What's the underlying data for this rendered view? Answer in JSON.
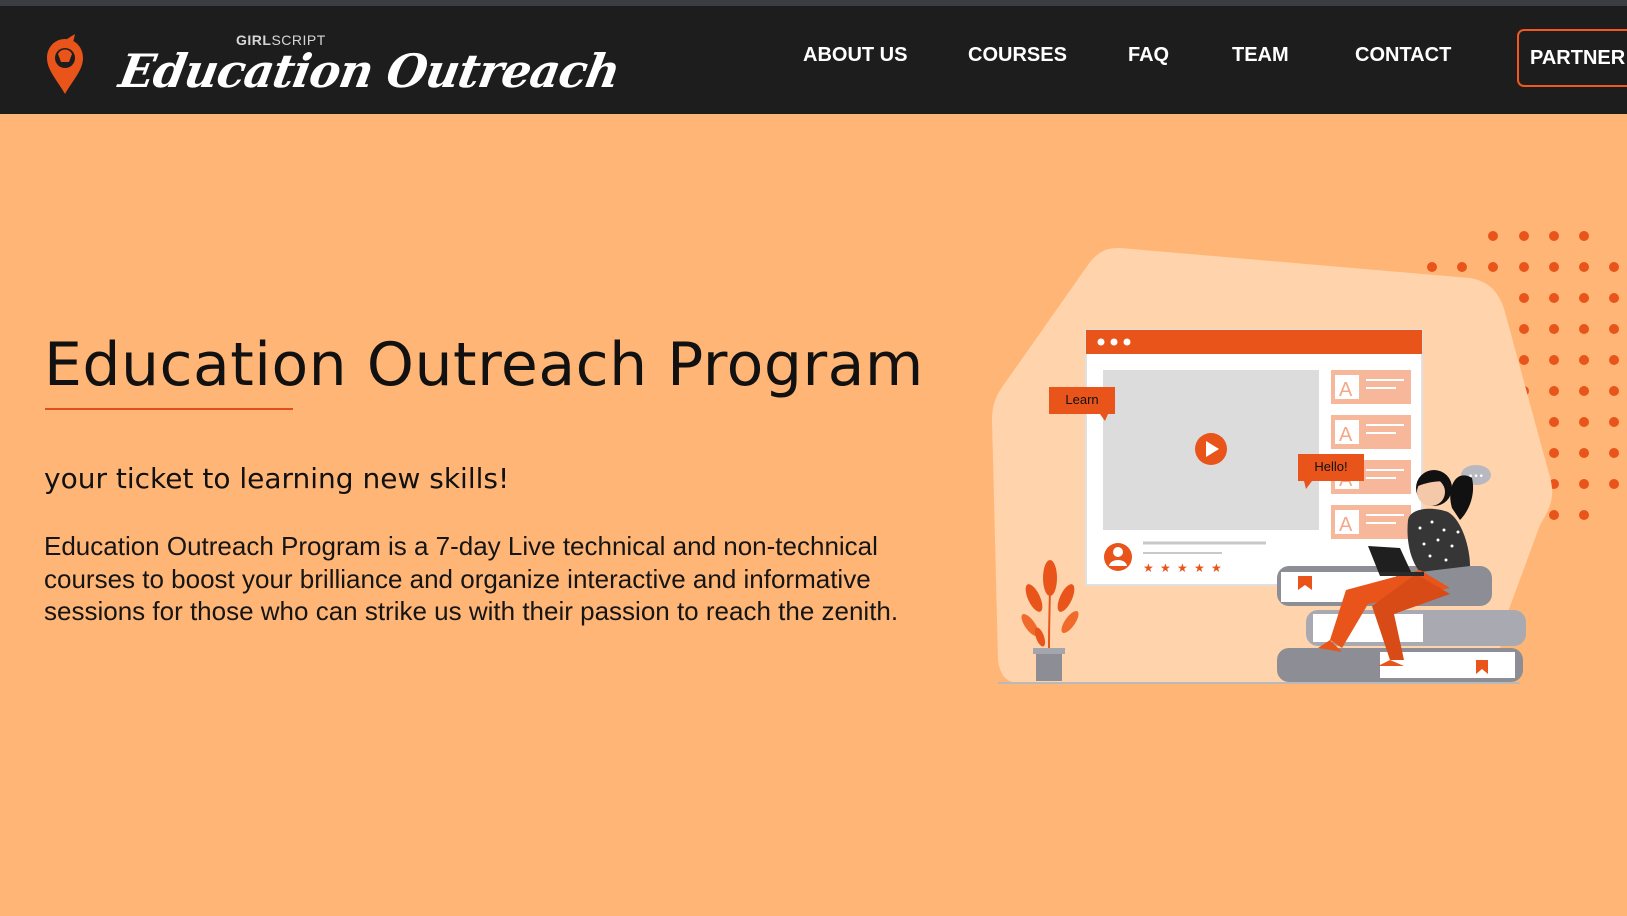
{
  "brand": {
    "small_prefix": "GIRL",
    "small_suffix": "SCRIPT",
    "script_name": "Education Outreach"
  },
  "nav": {
    "items": [
      {
        "label": "ABOUT US"
      },
      {
        "label": "COURSES"
      },
      {
        "label": "FAQ"
      },
      {
        "label": "TEAM"
      },
      {
        "label": "CONTACT"
      }
    ],
    "partner_label": "PARTNER"
  },
  "hero": {
    "title": "Education Outreach Program",
    "subtitle": "your ticket to learning new skills!",
    "description": "Education Outreach Program is a 7-day Live technical and non-technical courses to boost your brilliance and organize interactive and informative sessions for those who can strike us with their passion to reach the zenith."
  },
  "illustration": {
    "bubble_learn": "Learn",
    "bubble_hello": "Hello!",
    "bubble_dots": "•••",
    "card_letter": "A"
  },
  "colors": {
    "navbar_bg": "#1d1d1d",
    "page_bg": "#ffb575",
    "accent": "#e8541a",
    "blob": "#ffd3ab"
  }
}
